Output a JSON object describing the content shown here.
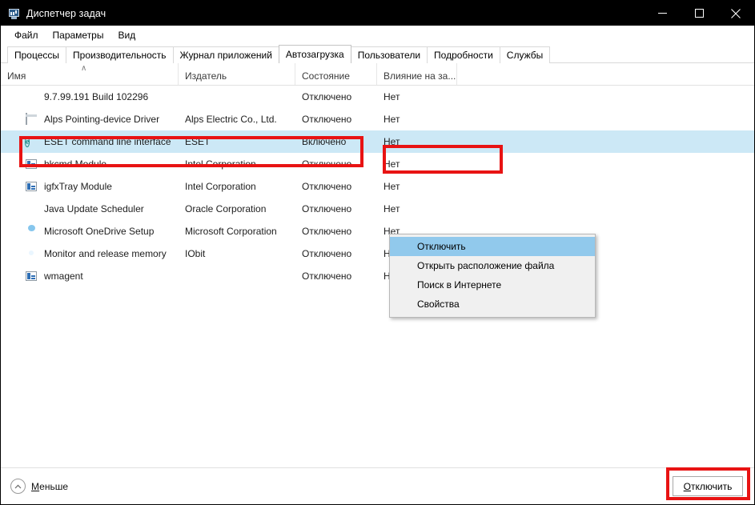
{
  "window": {
    "title": "Диспетчер задач",
    "icon": "task-manager-icon",
    "controls": {
      "minimize": "minimize-icon",
      "maximize": "maximize-icon",
      "close": "close-icon"
    }
  },
  "menubar": {
    "items": [
      {
        "label": "Файл"
      },
      {
        "label": "Параметры"
      },
      {
        "label": "Вид"
      }
    ]
  },
  "tabs": [
    {
      "label": "Процессы",
      "active": false
    },
    {
      "label": "Производительность",
      "active": false
    },
    {
      "label": "Журнал приложений",
      "active": false
    },
    {
      "label": "Автозагрузка",
      "active": true
    },
    {
      "label": "Пользователи",
      "active": false
    },
    {
      "label": "Подробности",
      "active": false
    },
    {
      "label": "Службы",
      "active": false
    }
  ],
  "table": {
    "columns": [
      {
        "label": "Имя",
        "sort": "ascending",
        "sort_glyph": "∧"
      },
      {
        "label": "Издатель"
      },
      {
        "label": "Состояние"
      },
      {
        "label": "Влияние на за..."
      }
    ],
    "rows": [
      {
        "icon": "green-circle-icon",
        "name": "9.7.99.191 Build 102296",
        "publisher": "",
        "state": "Отключено",
        "impact": "Нет",
        "selected": false
      },
      {
        "icon": "window-driver-icon",
        "name": "Alps Pointing-device Driver",
        "publisher": "Alps Electric Co., Ltd.",
        "state": "Отключено",
        "impact": "Нет",
        "selected": false
      },
      {
        "icon": "eset-icon",
        "name": "ESET command line interface",
        "publisher": "ESET",
        "state": "Включено",
        "impact": "Нет",
        "selected": true
      },
      {
        "icon": "module-icon",
        "name": "hkcmd Module",
        "publisher": "Intel Corporation",
        "state": "Отключено",
        "impact": "Нет",
        "selected": false
      },
      {
        "icon": "module-icon",
        "name": "igfxTray Module",
        "publisher": "Intel Corporation",
        "state": "Отключено",
        "impact": "Нет",
        "selected": false
      },
      {
        "icon": "java-icon",
        "name": "Java Update Scheduler",
        "publisher": "Oracle Corporation",
        "state": "Отключено",
        "impact": "Нет",
        "selected": false
      },
      {
        "icon": "onedrive-icon",
        "name": "Microsoft OneDrive Setup",
        "publisher": "Microsoft Corporation",
        "state": "Отключено",
        "impact": "Нет",
        "selected": false
      },
      {
        "icon": "iobit-icon",
        "name": "Monitor and release memory",
        "publisher": "IObit",
        "state": "Отключено",
        "impact": "Нет",
        "selected": false
      },
      {
        "icon": "module-icon",
        "name": "wmagent",
        "publisher": "",
        "state": "Отключено",
        "impact": "Нет",
        "selected": false
      }
    ]
  },
  "context_menu": {
    "items": [
      {
        "label": "Отключить",
        "highlighted": true
      },
      {
        "label": "Открыть расположение файла",
        "highlighted": false
      },
      {
        "label": "Поиск в Интернете",
        "highlighted": false
      },
      {
        "label": "Свойства",
        "highlighted": false
      }
    ]
  },
  "footer": {
    "less_label": "Меньше",
    "less_accel": "М",
    "less_rest": "еньше",
    "less_icon": "chevron-up-circle-icon",
    "disable_accel": "О",
    "disable_rest": "тключить",
    "disable_label": "Отключить"
  },
  "annotations": {
    "color": "#e81313",
    "boxes": [
      {
        "name": "selected-row-highlight"
      },
      {
        "name": "context-menu-disable-highlight"
      },
      {
        "name": "footer-disable-button-highlight"
      }
    ]
  }
}
